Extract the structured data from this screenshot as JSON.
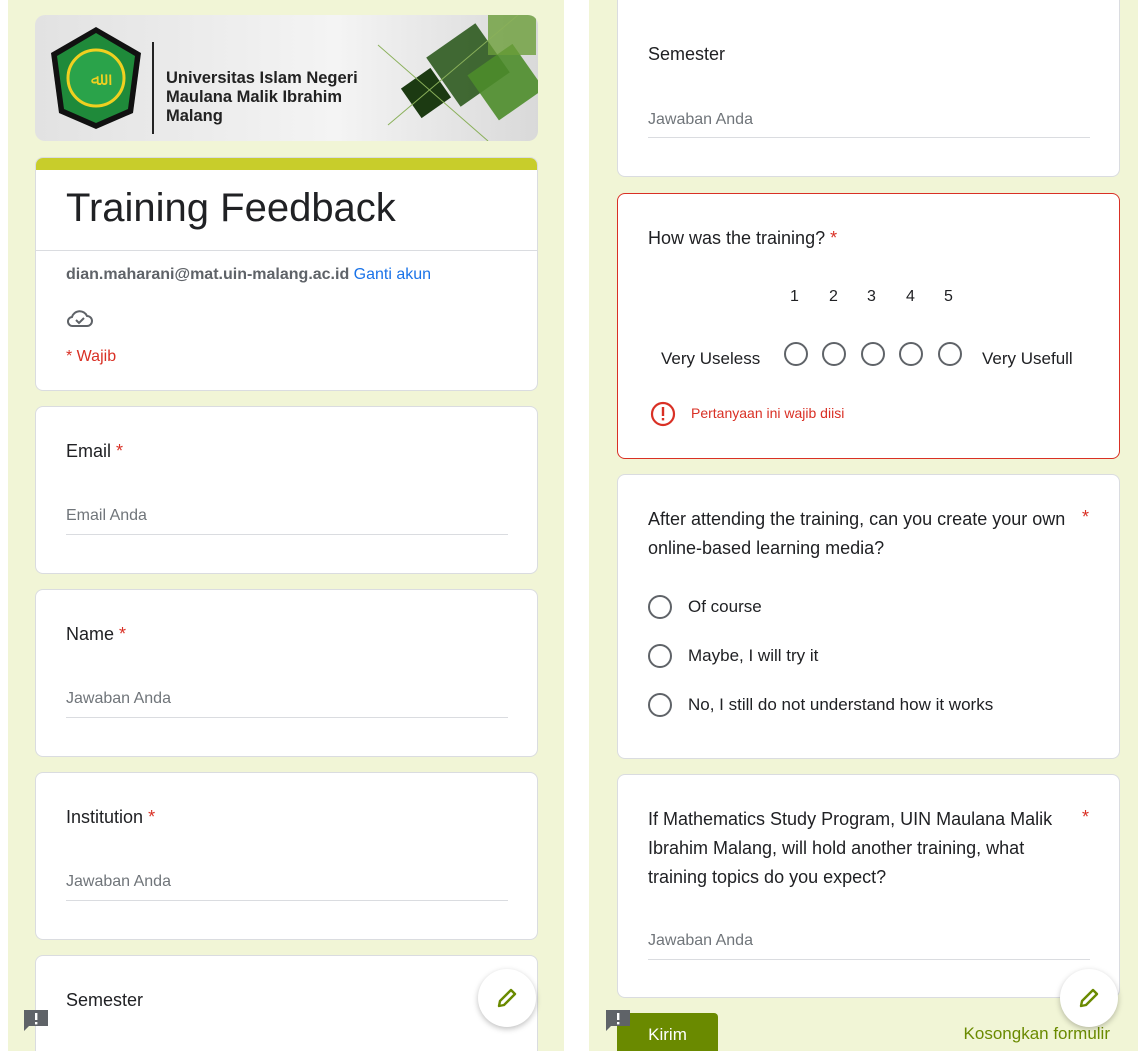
{
  "left": {
    "banner": {
      "university_line1": "Universitas Islam Negeri",
      "university_line2": "Maulana Malik Ibrahim",
      "university_line3": "Malang"
    },
    "form_title": "Training Feedback",
    "account_email": "dian.maharani@mat.uin-malang.ac.id",
    "switch_account": "Ganti akun",
    "required_note": "* Wajib",
    "questions": [
      {
        "label": "Email",
        "placeholder": "Email Anda"
      },
      {
        "label": "Name",
        "placeholder": "Jawaban Anda"
      },
      {
        "label": "Institution",
        "placeholder": "Jawaban Anda"
      },
      {
        "label": "Semester"
      }
    ],
    "required_mark": "*"
  },
  "right": {
    "semester": {
      "label": "Semester",
      "placeholder": "Jawaban Anda"
    },
    "rating": {
      "label": "How was the training?",
      "scale": [
        "1",
        "2",
        "3",
        "4",
        "5"
      ],
      "low_label": "Very Useless",
      "high_label": "Very Usefull",
      "error": "Pertanyaan ini wajib diisi"
    },
    "create_media": {
      "label": "After attending the training, can you create your own online-based learning media?",
      "options": [
        "Of course",
        "Maybe, I will try it",
        "No, I still do not understand how it works"
      ]
    },
    "topics": {
      "label": "If Mathematics Study Program, UIN Maulana Malik Ibrahim Malang, will hold another training, what training topics do you expect?",
      "placeholder": "Jawaban Anda"
    },
    "submit_label": "Kirim",
    "clear_label": "Kosongkan formulir"
  },
  "colors": {
    "page_bg": "#f1f5d6",
    "accent": "#c8cd2b",
    "submit_bg": "#6a8a00",
    "link": "#1a73e8",
    "error": "#d93025"
  }
}
